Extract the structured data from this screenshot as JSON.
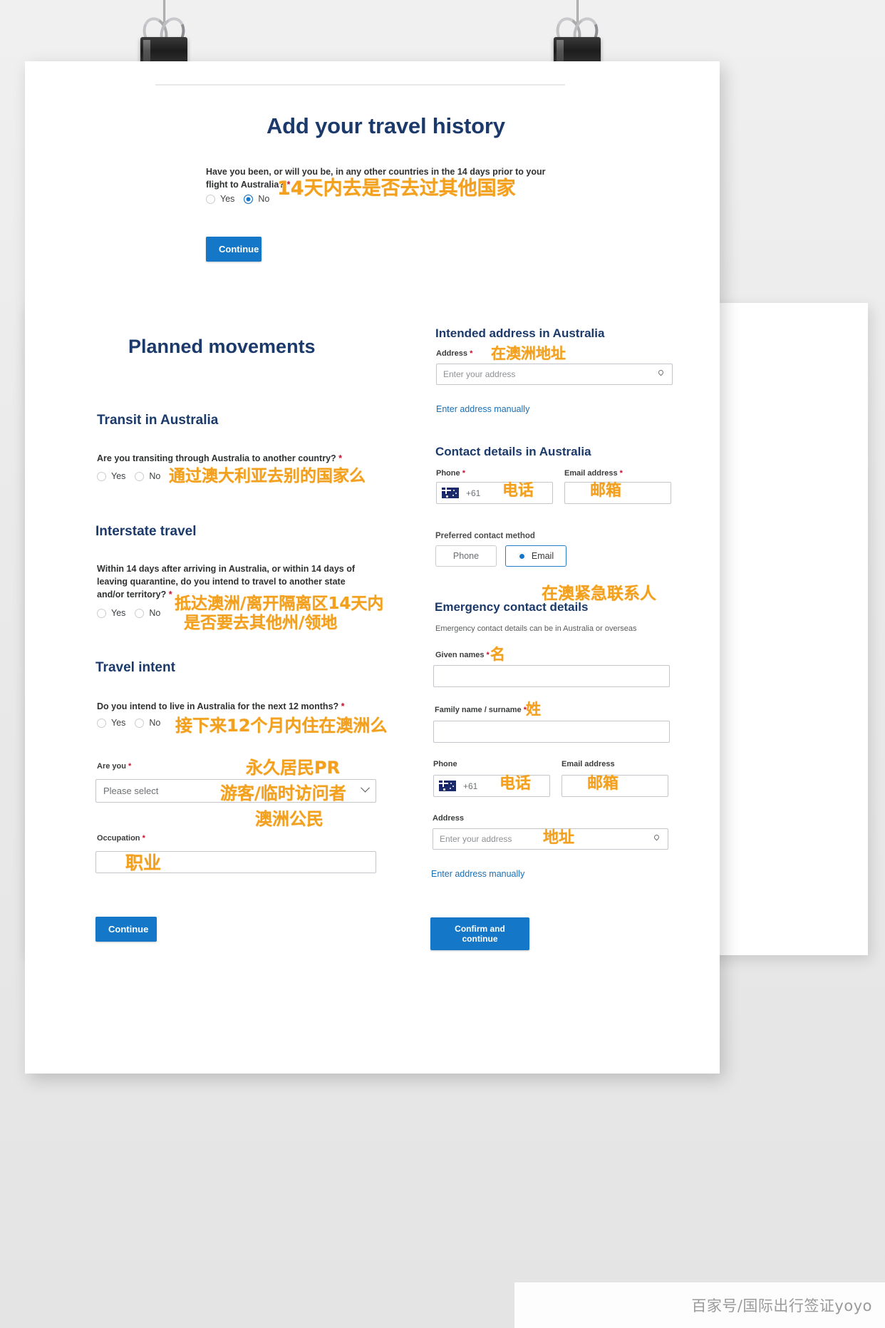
{
  "page": {
    "title": "Add your travel history"
  },
  "travel_history": {
    "question": "Have you been, or will you be, in any other countries in the 14 days prior to your flight to Australia?",
    "required_mark": "*",
    "yes_label": "Yes",
    "no_label": "No",
    "selected": "No",
    "annotation_cn": "14天内去是否去过其他国家",
    "continue_label": "Continue"
  },
  "planned_movements": {
    "heading": "Planned movements",
    "transit": {
      "heading": "Transit in Australia",
      "question": "Are you transiting through Australia to another country?",
      "required_mark": "*",
      "yes_label": "Yes",
      "no_label": "No",
      "annotation_cn": "通过澳大利亚去别的国家么"
    },
    "interstate": {
      "heading": "Interstate travel",
      "question": "Within 14 days after arriving in Australia, or within 14 days of leaving quarantine, do you intend to travel to another state and/or territory?",
      "required_mark": "*",
      "yes_label": "Yes",
      "no_label": "No",
      "annotation_cn_line1": "抵达澳洲/离开隔离区14天内",
      "annotation_cn_line2": "是否要去其他州/领地"
    },
    "intent": {
      "heading": "Travel intent",
      "question": "Do you intend to live in Australia for the next 12 months?",
      "required_mark": "*",
      "yes_label": "Yes",
      "no_label": "No",
      "annotation_cn": "接下来12个月内住在澳洲么"
    },
    "are_you": {
      "label": "Are you",
      "required_mark": "*",
      "selected_value": "Please select",
      "annotation_cn_line1": "永久居民PR",
      "annotation_cn_line2": "游客/临时访问者",
      "annotation_cn_line3": "澳洲公民"
    },
    "occupation": {
      "label": "Occupation",
      "required_mark": "*",
      "value": "",
      "annotation_cn": "职业"
    },
    "continue_label": "Continue"
  },
  "intended_address": {
    "heading": "Intended address in Australia",
    "address_label": "Address",
    "required_mark": "*",
    "address_placeholder": "Enter your address",
    "manual_link": "Enter address manually",
    "annotation_cn": "在澳洲地址"
  },
  "contact_details": {
    "heading": "Contact details in Australia",
    "phone_label": "Phone",
    "phone_required": "*",
    "phone_country_code": "+61",
    "phone_annotation_cn": "电话",
    "email_label": "Email address",
    "email_required": "*",
    "email_annotation_cn": "邮箱",
    "preferred_label": "Preferred contact method",
    "option_phone": "Phone",
    "option_email": "Email",
    "preferred_selected": "Email"
  },
  "emergency_contact": {
    "heading": "Emergency contact details",
    "annotation_cn": "在澳紧急联系人",
    "subtitle": "Emergency contact details can be in Australia or overseas",
    "given_names_label": "Given names",
    "given_names_required": "*",
    "given_names_annotation_cn": "名",
    "family_name_label": "Family name / surname",
    "family_name_required": "*",
    "family_name_annotation_cn": "姓",
    "phone_label": "Phone",
    "phone_country_code": "+61",
    "phone_annotation_cn": "电话",
    "email_label": "Email address",
    "email_annotation_cn": "邮箱",
    "address_label": "Address",
    "address_placeholder": "Enter your address",
    "address_annotation_cn": "地址",
    "manual_link": "Enter address manually",
    "confirm_label": "Confirm and continue"
  },
  "watermark": "百家号/国际出行签证yoyo",
  "colors": {
    "heading_blue": "#1b3a6b",
    "button_blue": "#1477c7",
    "annotation_orange": "#f2a01e",
    "link_blue": "#1a6fb5",
    "required_red": "#c8102e"
  }
}
